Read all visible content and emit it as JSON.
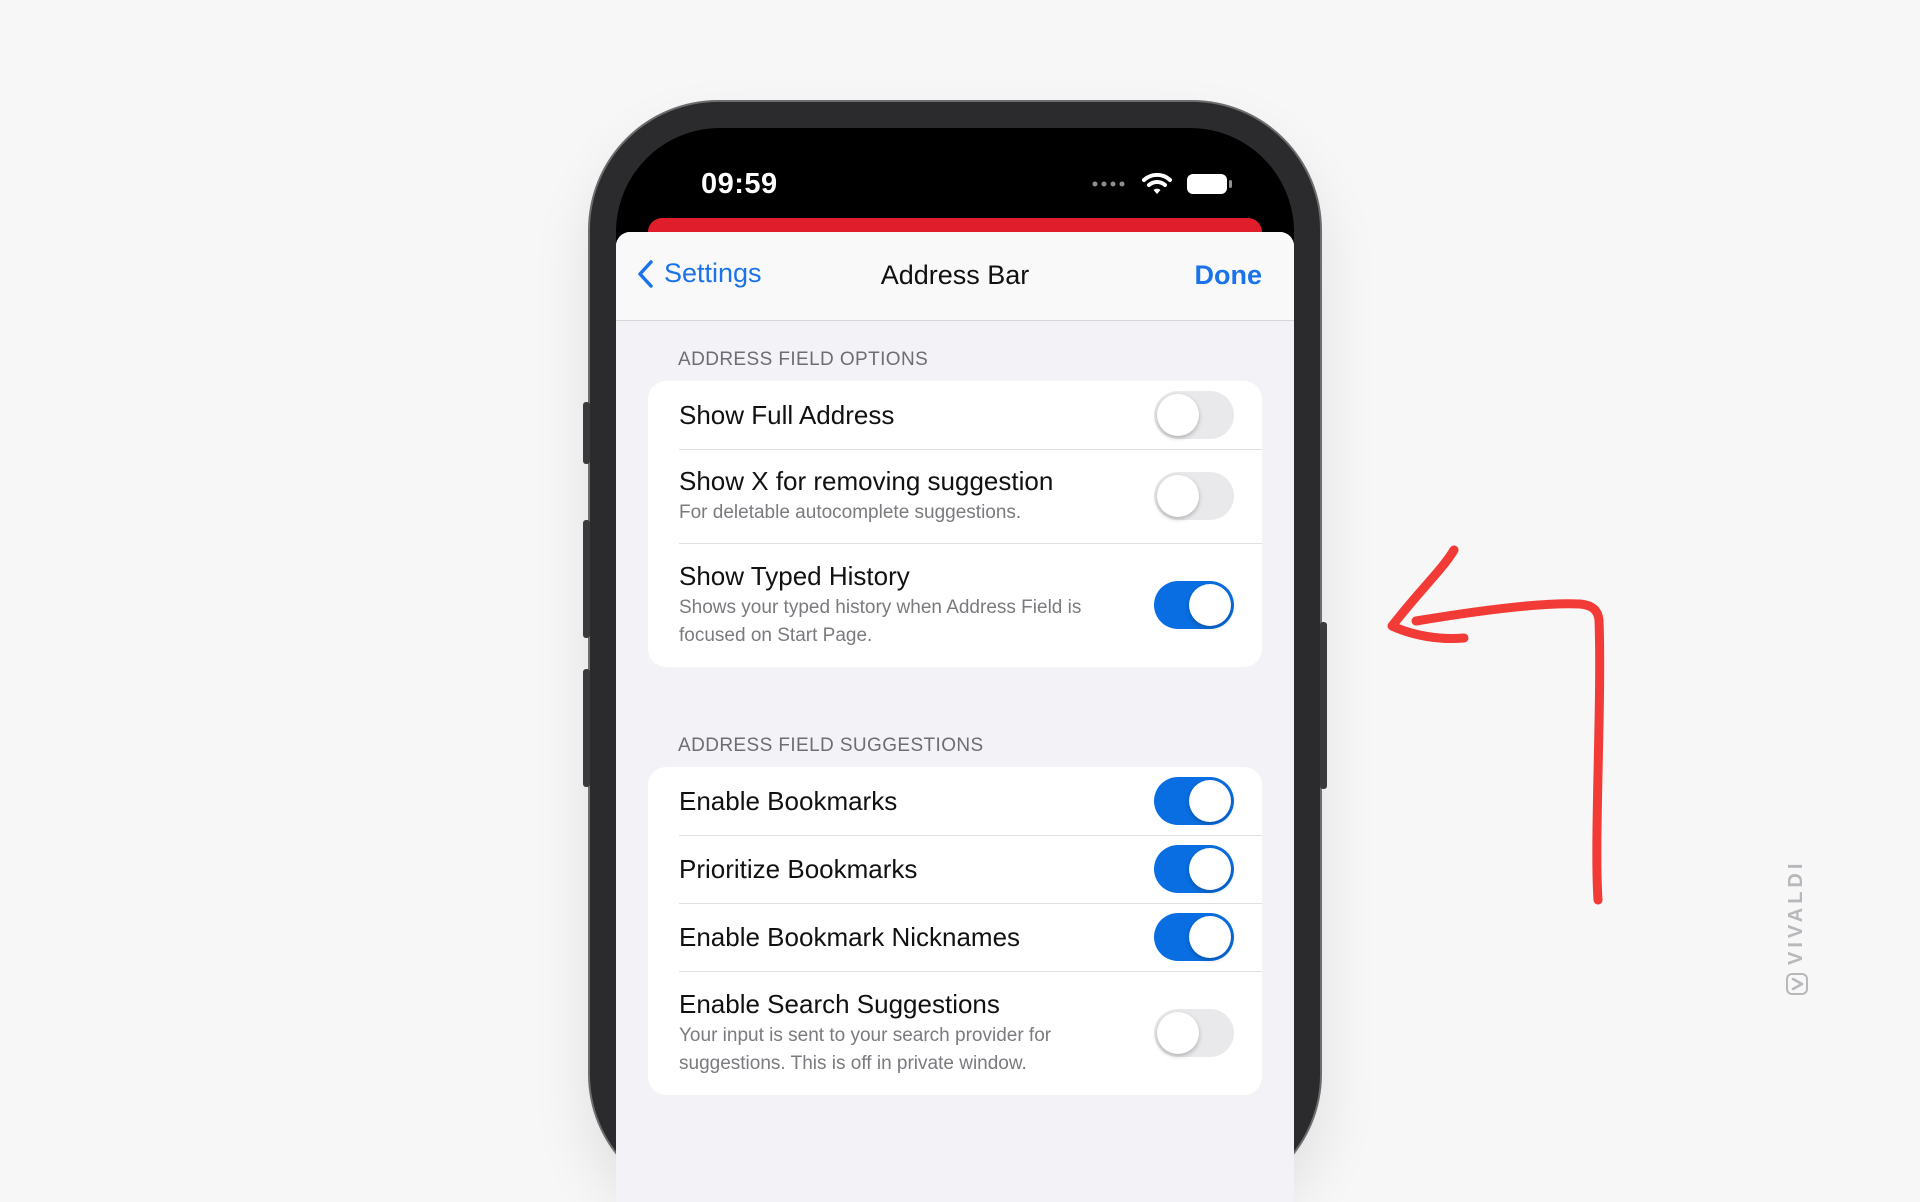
{
  "status_bar": {
    "time": "09:59"
  },
  "nav": {
    "back_label": "Settings",
    "title": "Address Bar",
    "done_label": "Done"
  },
  "sections": [
    {
      "header": "ADDRESS FIELD OPTIONS",
      "rows": [
        {
          "title": "Show Full Address",
          "subtitle": "",
          "on": false
        },
        {
          "title": "Show X for removing suggestion",
          "subtitle": "For deletable autocomplete suggestions.",
          "on": false
        },
        {
          "title": "Show Typed History",
          "subtitle": "Shows your typed history when Address Field is focused on Start Page.",
          "on": true
        }
      ]
    },
    {
      "header": "ADDRESS FIELD SUGGESTIONS",
      "rows": [
        {
          "title": "Enable Bookmarks",
          "subtitle": "",
          "on": true
        },
        {
          "title": "Prioritize Bookmarks",
          "subtitle": "",
          "on": true
        },
        {
          "title": "Enable Bookmark Nicknames",
          "subtitle": "",
          "on": true
        },
        {
          "title": "Enable Search Suggestions",
          "subtitle": "Your input is sent to your search provider for suggestions. This is off in private window.",
          "on": false
        }
      ]
    }
  ],
  "watermark": "VIVALDI",
  "colors": {
    "accent": "#0a6ee3",
    "link": "#1a73e8",
    "toolbar_red": "#e01e2b",
    "annotation_arrow": "#f23a36"
  },
  "icons": [
    "chevron-left-icon",
    "wifi-icon",
    "battery-icon",
    "signal-dots-icon",
    "annotation-arrow-icon",
    "vivaldi-logo-icon"
  ]
}
